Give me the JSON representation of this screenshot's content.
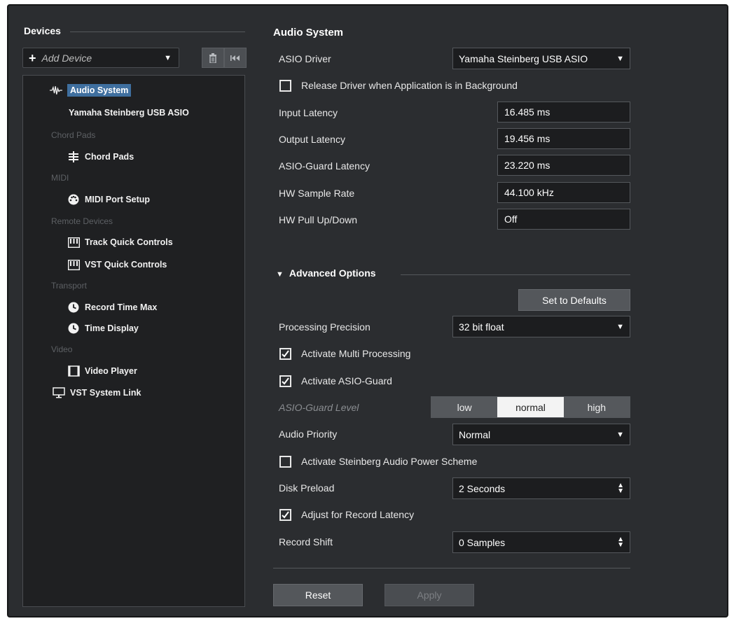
{
  "devices_panel": {
    "title": "Devices",
    "add_device_label": "Add Device",
    "tree": {
      "audio_system": "Audio System",
      "audio_driver": "Yamaha Steinberg USB ASIO",
      "cat_chord_pads": "Chord Pads",
      "chord_pads": "Chord Pads",
      "cat_midi": "MIDI",
      "midi_port_setup": "MIDI Port Setup",
      "cat_remote": "Remote Devices",
      "track_quick_controls": "Track Quick Controls",
      "vst_quick_controls": "VST Quick Controls",
      "cat_transport": "Transport",
      "record_time_max": "Record Time Max",
      "time_display": "Time Display",
      "cat_video": "Video",
      "video_player": "Video Player",
      "vst_system_link": "VST System Link"
    }
  },
  "audio_system": {
    "title": "Audio System",
    "asio_driver_label": "ASIO Driver",
    "asio_driver_value": "Yamaha Steinberg USB ASIO",
    "release_driver_label": "Release Driver when Application is in Background",
    "release_driver_checked": false,
    "input_latency_label": "Input Latency",
    "input_latency_value": "16.485 ms",
    "output_latency_label": "Output Latency",
    "output_latency_value": "19.456 ms",
    "asio_guard_latency_label": "ASIO-Guard Latency",
    "asio_guard_latency_value": "23.220 ms",
    "hw_sample_rate_label": "HW Sample Rate",
    "hw_sample_rate_value": "44.100 kHz",
    "hw_pull_label": "HW Pull Up/Down",
    "hw_pull_value": "Off"
  },
  "advanced": {
    "title": "Advanced Options",
    "set_defaults_label": "Set to Defaults",
    "processing_precision_label": "Processing Precision",
    "processing_precision_value": "32 bit float",
    "multi_processing_label": "Activate Multi Processing",
    "multi_processing_checked": true,
    "asio_guard_label": "Activate ASIO-Guard",
    "asio_guard_checked": true,
    "asio_guard_level_label": "ASIO-Guard Level",
    "asio_guard_levels": [
      "low",
      "normal",
      "high"
    ],
    "asio_guard_level_selected": "normal",
    "audio_priority_label": "Audio Priority",
    "audio_priority_value": "Normal",
    "power_scheme_label": "Activate Steinberg Audio Power Scheme",
    "power_scheme_checked": false,
    "disk_preload_label": "Disk Preload",
    "disk_preload_value": "2 Seconds",
    "adjust_record_latency_label": "Adjust for Record Latency",
    "adjust_record_latency_checked": true,
    "record_shift_label": "Record Shift",
    "record_shift_value": "0 Samples"
  },
  "footer": {
    "reset_label": "Reset",
    "apply_label": "Apply"
  },
  "colors": {
    "window_bg": "#2b2d30",
    "selection": "#3f6f9f",
    "segment_selected": "#f3f3f3"
  }
}
